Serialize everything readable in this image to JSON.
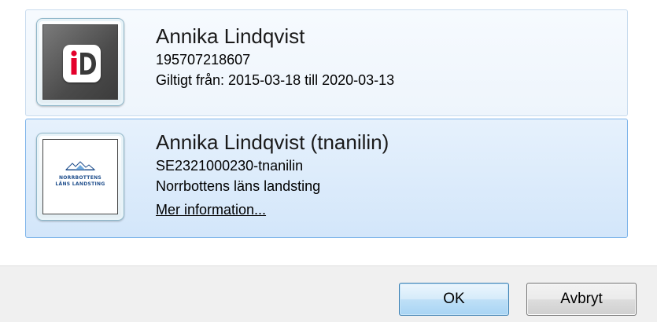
{
  "certificates": [
    {
      "name": "Annika Lindqvist",
      "line1": "195707218607",
      "line2": "Giltigt från: 2015-03-18 till 2020-03-13",
      "icon": "bankid-icon"
    },
    {
      "name": "Annika Lindqvist (tnanilin)",
      "line1": "SE2321000230-tnanilin",
      "line2": "Norrbottens läns landsting",
      "link": "Mer information...",
      "icon": "norrbottens-lans-landsting-logo",
      "logo_text_1": "NORRBOTTENS",
      "logo_text_2": "LÄNS LANDSTING"
    }
  ],
  "buttons": {
    "ok_label": "OK",
    "cancel_label": "Avbryt"
  },
  "colors": {
    "selected_bg": "#d3e6fa",
    "selected_border": "#7eb4ea",
    "hover_bg": "#eef5fc",
    "bankid_red": "#e4002b",
    "footer_bg": "#f0f0f0"
  }
}
